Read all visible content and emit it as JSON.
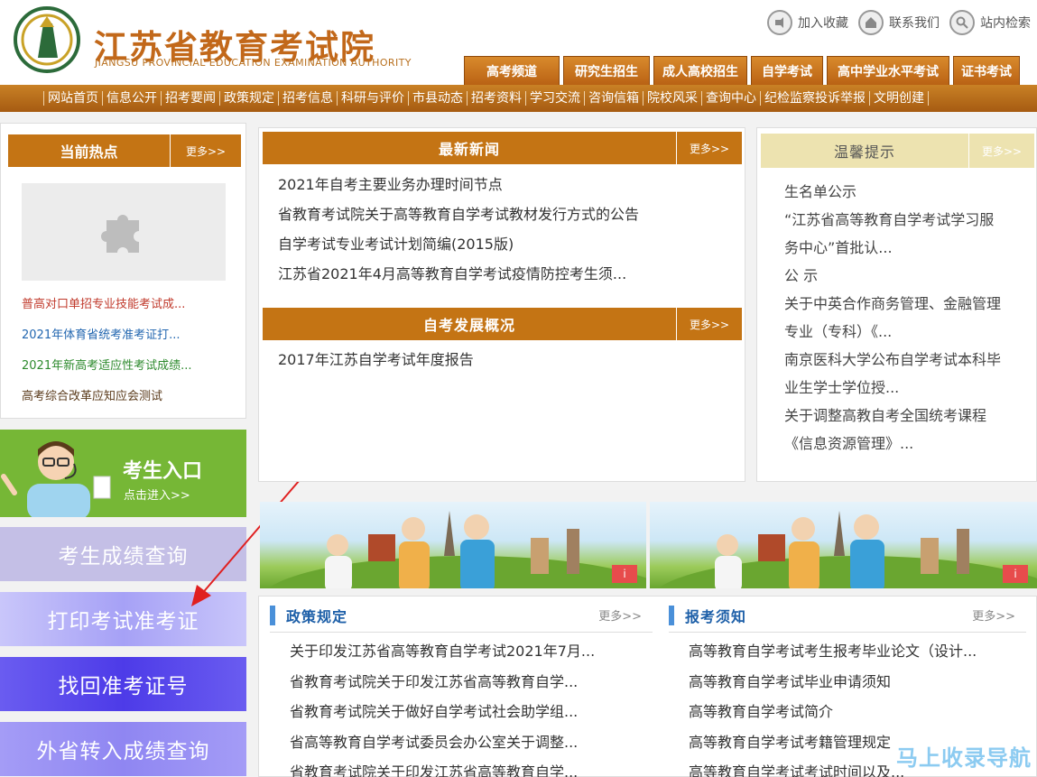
{
  "header": {
    "title": "江苏省教育考试院",
    "subtitle": "JIANGSU PROVINCIAL EDUCATION EXAMINATION AUTHORITY",
    "top_links": [
      "加入收藏",
      "联系我们",
      "站内检索"
    ],
    "category_tabs": [
      "高考频道",
      "研究生招生",
      "成人高校招生",
      "自学考试",
      "高中学业水平考试",
      "证书考试"
    ]
  },
  "nav": {
    "items": [
      "网站首页",
      "信息公开",
      "招考要闻",
      "政策规定",
      "招考信息",
      "科研与评价",
      "市县动态",
      "招考资料",
      "学习交流",
      "咨询信箱",
      "院校风采",
      "查询中心",
      "纪检监察投诉举报",
      "文明创建"
    ]
  },
  "hot": {
    "title": "当前热点",
    "more": "更多>>",
    "items": [
      {
        "text": "普高对口单招专业技能考试成...",
        "color": "#c0392b"
      },
      {
        "text": "2021年体育省统考准考证打...",
        "color": "#2367b0"
      },
      {
        "text": "2021年新高考适应性考试成绩...",
        "color": "#2d8a2d"
      },
      {
        "text": "高考综合改革应知应会测试",
        "color": "#5a3a1a"
      }
    ]
  },
  "entry": {
    "title": "考生入口",
    "sub": "点击进入>>"
  },
  "buttons": [
    {
      "label": "考生成绩查询",
      "bg": "#c4bfe6"
    },
    {
      "label": "打印考试准考证",
      "bg": "#aeaaf8"
    },
    {
      "label": "找回准考证号",
      "bg": "#6f5df2"
    },
    {
      "label": "外省转入成绩查询",
      "bg": "#9b93f4"
    }
  ],
  "news": {
    "title": "最新新闻",
    "more": "更多>>",
    "items": [
      "2021年自考主要业务办理时间节点",
      "省教育考试院关于高等教育自学考试教材发行方式的公告",
      "自学考试专业考试计划简编(2015版)",
      "江苏省2021年4月高等教育自学考试疫情防控考生须..."
    ]
  },
  "overview": {
    "title": "自考发展概况",
    "more": "更多>>",
    "items": [
      "2017年江苏自学考试年度报告"
    ]
  },
  "tips": {
    "title": "温馨提示",
    "more": "更多>>",
    "items": [
      "生名单公示",
      "“江苏省高等教育自学考试学习服",
      "务中心”首批认...",
      "公 示",
      "关于中英合作商务管理、金融管理",
      "专业（专科）《...",
      "南京医科大学公布自学考试本科毕",
      "业生学士学位授...",
      "关于调整高教自考全国统考课程",
      "《信息资源管理》..."
    ]
  },
  "banner_badge": "i",
  "policy": {
    "title": "政策规定",
    "more": "更多>>",
    "items": [
      "关于印发江苏省高等教育自学考试2021年7月...",
      "省教育考试院关于印发江苏省高等教育自学...",
      "省教育考试院关于做好自学考试社会助学组...",
      "省高等教育自学考试委员会办公室关于调整...",
      "省教育考试院关于印发江苏省高等教育自学..."
    ]
  },
  "notice": {
    "title": "报考须知",
    "more": "更多>>",
    "items": [
      "高等教育自学考试考生报考毕业论文（设计...",
      "高等教育自学考试毕业申请须知",
      "高等教育自学考试简介",
      "高等教育自学考试考籍管理规定",
      "高等教育自学考试考试时间以及..."
    ]
  },
  "watermark": "马上收录导航"
}
